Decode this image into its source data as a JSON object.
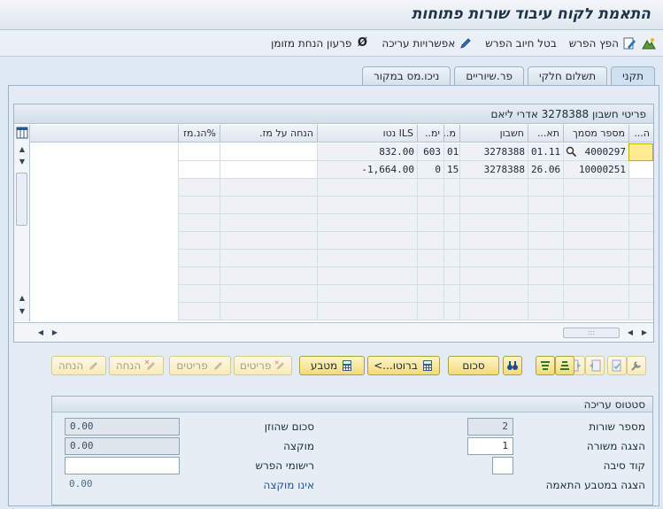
{
  "window": {
    "title": "התאמת לקוח עיבוד שורות פתוחות"
  },
  "toolbar": {
    "items": [
      {
        "label": "",
        "icon": "mountain-icon"
      },
      {
        "label": "הפץ הפרש",
        "icon": "edit-document-icon"
      },
      {
        "label": "בטל חיוב הפרש",
        "icon": ""
      },
      {
        "label": "אפשרויות עריכה",
        "icon": "pencil-icon"
      },
      {
        "label": "פרעון הנחת מזומן",
        "icon": "strikethrough-zero-icon"
      }
    ]
  },
  "tabs": [
    {
      "label": "תקני",
      "active": true
    },
    {
      "label": "תשלום חלקי",
      "active": false
    },
    {
      "label": "פר.שיוריים",
      "active": false
    },
    {
      "label": "ניכו.מס במקור",
      "active": false
    }
  ],
  "grid": {
    "caption": "פריטי חשבון 3278388 אדרי ליאם",
    "columns": [
      "ה...",
      "מספר מסמך",
      "תא...",
      "חשבון",
      "מ..",
      "ימ..",
      "ILS נטו",
      "הנחה על מז.",
      "%הנ.מז"
    ],
    "rows": [
      {
        "doc": "4000297",
        "date": "01.11",
        "account": "3278388",
        "m": "01",
        "days": "603",
        "net": "832.00"
      },
      {
        "doc": "10000251",
        "date": "26.06",
        "account": "3278388",
        "m": "15",
        "days": "0",
        "net": "-1,664.00"
      }
    ]
  },
  "actions": {
    "buttons": [
      {
        "label": "",
        "icon": "wrench-icon",
        "disabled": true
      },
      {
        "label": "",
        "icon": "doc-check-icon",
        "disabled": true
      },
      {
        "label": "",
        "icon": "doc-left-icon",
        "disabled": true
      },
      {
        "label": "",
        "icon": "doc-right-icon",
        "disabled": true
      },
      {
        "label": "",
        "icon": "align-bottom-icon",
        "disabled": false
      },
      {
        "label": "",
        "icon": "align-top-icon",
        "disabled": false
      },
      {
        "label": "",
        "icon": "binoculars-icon",
        "disabled": false
      },
      {
        "label": "סכום",
        "icon": "",
        "disabled": false
      },
      {
        "label": "ברוטו...>",
        "icon": "calculator-icon",
        "disabled": false
      },
      {
        "label": "מטבע",
        "icon": "calculator-icon",
        "disabled": false
      },
      {
        "label": "פריטים",
        "icon": "pencil-x-icon",
        "disabled": true
      },
      {
        "label": "פריטים",
        "icon": "pencil-icon",
        "disabled": true
      },
      {
        "label": "הנחה",
        "icon": "pencil-x-icon",
        "disabled": true
      },
      {
        "label": "הנחה",
        "icon": "pencil-icon",
        "disabled": true
      }
    ]
  },
  "status": {
    "title": "סטטוס עריכה",
    "right": [
      {
        "label": "מספר שורות",
        "value": "2",
        "editable": false
      },
      {
        "label": "הצגה משורה",
        "value": "1",
        "editable": true
      },
      {
        "label": "קוד סיבה",
        "value": "",
        "editable": true
      },
      {
        "label": "הצגה במטבע התאמה",
        "value": "",
        "editable": false
      }
    ],
    "left": [
      {
        "label": "סכום שהוזן",
        "value": "0.00",
        "editable": false
      },
      {
        "label": "מוקצה",
        "value": "0.00",
        "editable": false
      },
      {
        "label": "רישומי הפרש",
        "value": "",
        "editable": true
      },
      {
        "label": "אינו מוקצה",
        "value": "0.00",
        "editable": false
      }
    ]
  }
}
